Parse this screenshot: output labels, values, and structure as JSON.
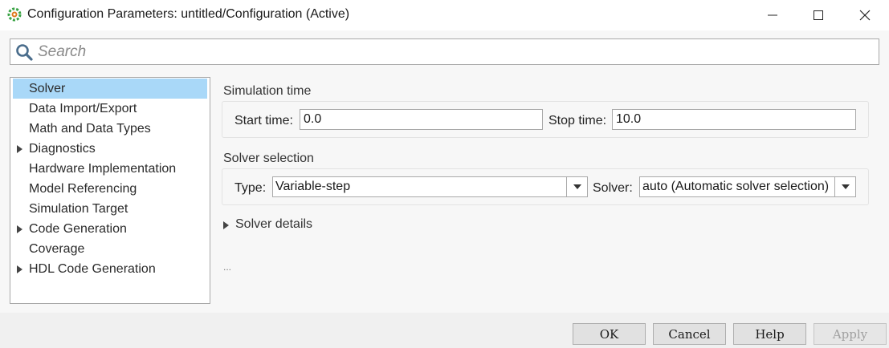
{
  "window": {
    "title": "Configuration Parameters: untitled/Configuration (Active)",
    "controls": [
      "minimize-icon",
      "maximize-icon",
      "close-icon"
    ]
  },
  "search": {
    "placeholder": "Search",
    "value": ""
  },
  "tree": {
    "items": [
      {
        "label": "Solver",
        "selected": true,
        "expandable": false
      },
      {
        "label": "Data Import/Export",
        "selected": false,
        "expandable": false
      },
      {
        "label": "Math and Data Types",
        "selected": false,
        "expandable": false
      },
      {
        "label": "Diagnostics",
        "selected": false,
        "expandable": true
      },
      {
        "label": "Hardware Implementation",
        "selected": false,
        "expandable": false
      },
      {
        "label": "Model Referencing",
        "selected": false,
        "expandable": false
      },
      {
        "label": "Simulation Target",
        "selected": false,
        "expandable": false
      },
      {
        "label": "Code Generation",
        "selected": false,
        "expandable": true
      },
      {
        "label": "Coverage",
        "selected": false,
        "expandable": false
      },
      {
        "label": "HDL Code Generation",
        "selected": false,
        "expandable": true
      }
    ]
  },
  "simulation_time": {
    "title": "Simulation time",
    "start_label": "Start time:",
    "start_value": "0.0",
    "stop_label": "Stop time:",
    "stop_value": "10.0"
  },
  "solver_selection": {
    "title": "Solver selection",
    "type_label": "Type:",
    "type_value": "Variable-step",
    "solver_label": "Solver:",
    "solver_value": "auto (Automatic solver selection)"
  },
  "solver_details": {
    "label": "Solver details"
  },
  "ellipsis": "...",
  "buttons": {
    "ok": "OK",
    "cancel": "Cancel",
    "help": "Help",
    "apply": "Apply"
  },
  "colors": {
    "selection": "#a9d8f8",
    "panel_bg": "#f7f7f7"
  }
}
